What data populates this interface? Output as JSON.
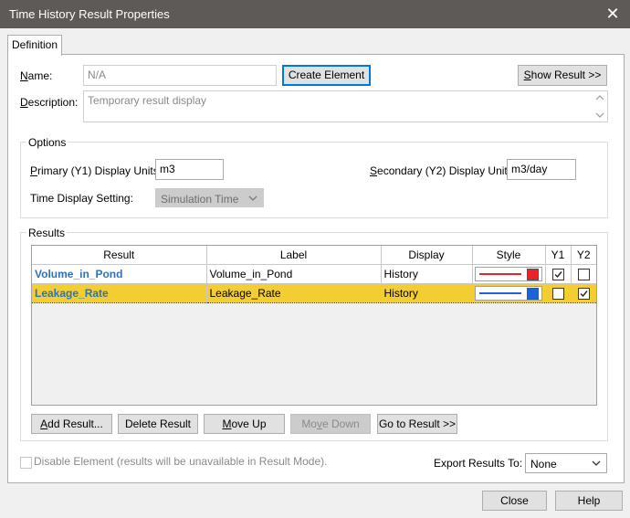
{
  "window": {
    "title": "Time History Result Properties",
    "close_glyph": "✕"
  },
  "tabs": [
    {
      "label": "Definition",
      "active": true
    }
  ],
  "definition": {
    "name_label": "Name:",
    "name_value": "N/A",
    "create_element_label": "Create Element",
    "show_result_label": "Show Result >>",
    "description_label": "Description:",
    "description_value": "Temporary result display"
  },
  "options": {
    "group_label": "Options",
    "primary_label": "Primary (Y1) Display Units:",
    "primary_value": "m3",
    "secondary_label": "Secondary (Y2) Display Units:",
    "secondary_value": "m3/day",
    "time_display_label": "Time Display Setting:",
    "time_display_value": "Simulation Time"
  },
  "results": {
    "group_label": "Results",
    "columns": [
      "Result",
      "Label",
      "Display",
      "Style",
      "Y1",
      "Y2"
    ],
    "rows": [
      {
        "result": "Volume_in_Pond",
        "label": "Volume_in_Pond",
        "display": "History",
        "style_color": "#e8232a",
        "y1": true,
        "y2": false,
        "selected": false
      },
      {
        "result": "Leakage_Rate",
        "label": "Leakage_Rate",
        "display": "History",
        "style_color": "#1a63d8",
        "y1": false,
        "y2": true,
        "selected": true
      }
    ],
    "buttons": {
      "add": "Add Result...",
      "delete": "Delete Result",
      "move_up": "Move Up",
      "move_down": "Move Down",
      "go_to": "Go to Result >>"
    }
  },
  "footer": {
    "disable_label": "Disable Element (results will be unavailable in Result Mode).",
    "export_label": "Export Results To:",
    "export_value": "None",
    "close_label": "Close",
    "help_label": "Help"
  },
  "colors": {
    "titlebar": "#5e5a57",
    "selection": "#f3cd31",
    "result_name": "#2e73b8",
    "focus": "#0078d7"
  }
}
